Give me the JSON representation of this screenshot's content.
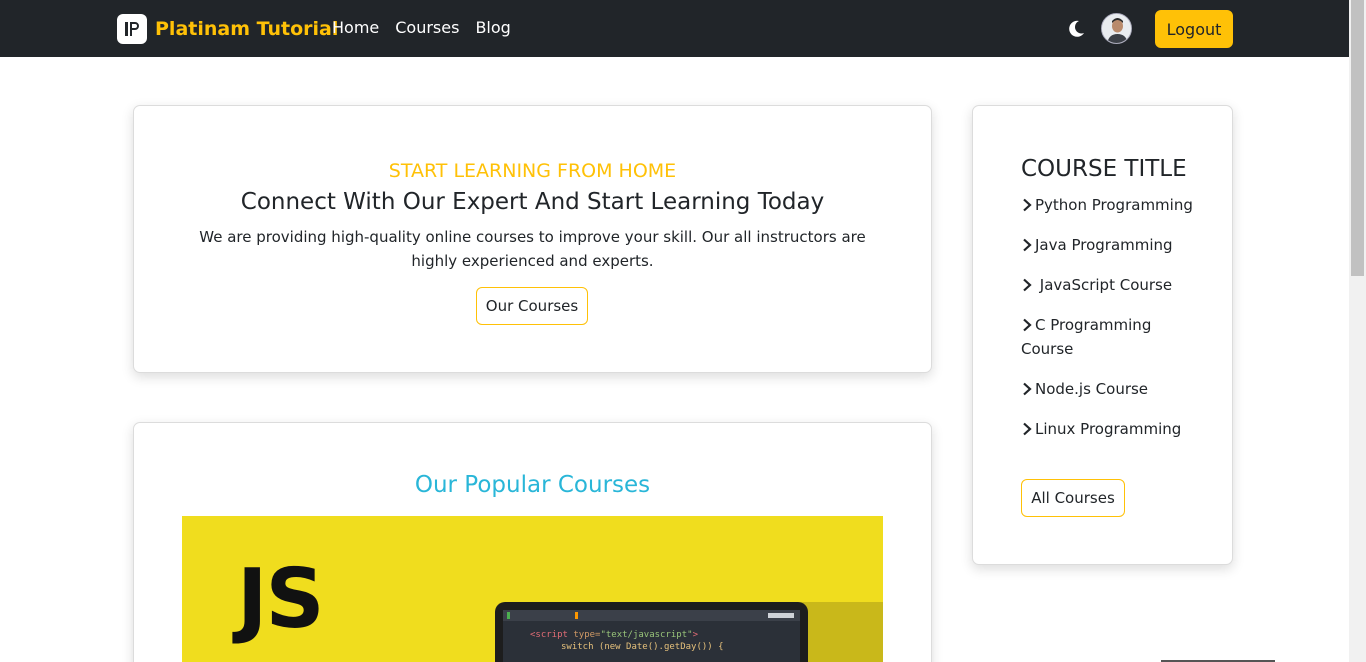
{
  "navbar": {
    "brand": "Platinam Tutorial",
    "links": [
      "Home",
      "Courses",
      "Blog"
    ],
    "logout_label": "Logout",
    "accent": "#ffc107",
    "background": "#212529"
  },
  "hero": {
    "eyebrow": "START LEARNING FROM HOME",
    "title": "Connect With Our Expert And Start Learning Today",
    "text": "We are providing high-quality online courses to improve your skill. Our all instructors are highly experienced and experts.",
    "button_label": "Our Courses"
  },
  "popular": {
    "title": "Our Popular Courses",
    "banner": {
      "logo_text": "JS",
      "code_line_1_tag": "<script ",
      "code_line_1_attr": "type=",
      "code_line_1_val": "\"text/javascript\"",
      "code_line_1_end": ">",
      "code_line_2": "switch (new Date().getDay()) {"
    }
  },
  "sidebar": {
    "title": "COURSE TITLE",
    "courses": [
      "Python Programming",
      "Java Programming",
      " JavaScript Course",
      "C Programming Course",
      "Node.js Course",
      "Linux Programming"
    ],
    "button_label": "All Courses"
  },
  "icons": {
    "theme_toggle": "moon-icon",
    "course_bullet": "chevron-right-icon",
    "avatar": "user-avatar"
  },
  "colors": {
    "popular_title": "#29b6d8",
    "banner": "#f0dd1e"
  }
}
